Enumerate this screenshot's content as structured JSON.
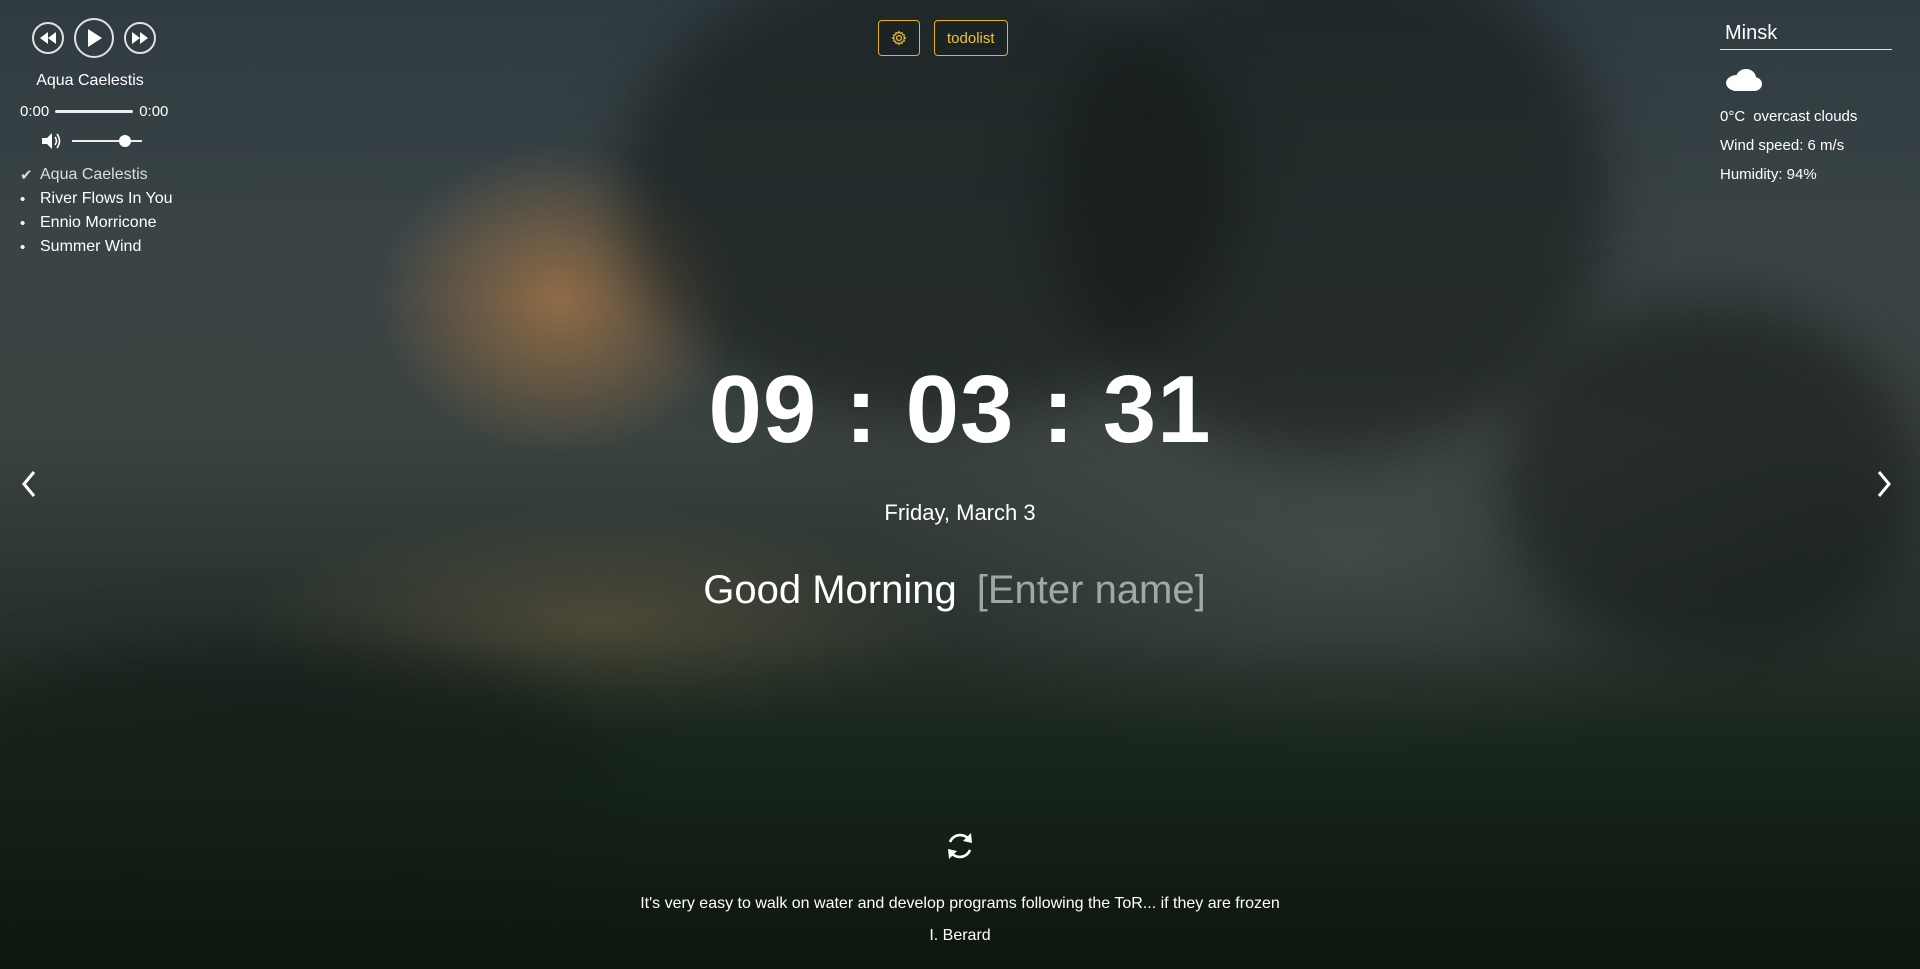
{
  "player": {
    "track_title": "Aqua Caelestis",
    "current_time": "0:00",
    "duration": "0:00",
    "progress": 0,
    "volume": 0.75,
    "playlist": [
      {
        "label": "Aqua Caelestis",
        "active": true
      },
      {
        "label": "River Flows In You",
        "active": false
      },
      {
        "label": "Ennio Morricone",
        "active": false
      },
      {
        "label": "Summer Wind",
        "active": false
      }
    ],
    "icons": {
      "prev": "rewind-icon",
      "play": "play-icon",
      "next": "fast-forward-icon",
      "volume": "volume-icon",
      "active_mark": "check-icon"
    }
  },
  "header": {
    "settings_icon": "gear-icon",
    "todo_label": "todolist",
    "accent_color": "#e8b31b"
  },
  "weather": {
    "city": "Minsk",
    "icon": "cloud-icon",
    "temperature": "0°C",
    "description": "overcast clouds",
    "wind": "Wind speed: 6 m/s",
    "humidity": "Humidity: 94%"
  },
  "clock": {
    "time": "09 : 03 : 31",
    "date": "Friday, March 3"
  },
  "greeting": {
    "text": "Good Morning",
    "name_placeholder": "[Enter name]"
  },
  "slider": {
    "prev_icon": "chevron-left-icon",
    "next_icon": "chevron-right-icon"
  },
  "quote": {
    "refresh_icon": "refresh-icon",
    "text": "It's very easy to walk on water and develop programs following the ToR... if they are frozen",
    "author": "I. Berard"
  }
}
